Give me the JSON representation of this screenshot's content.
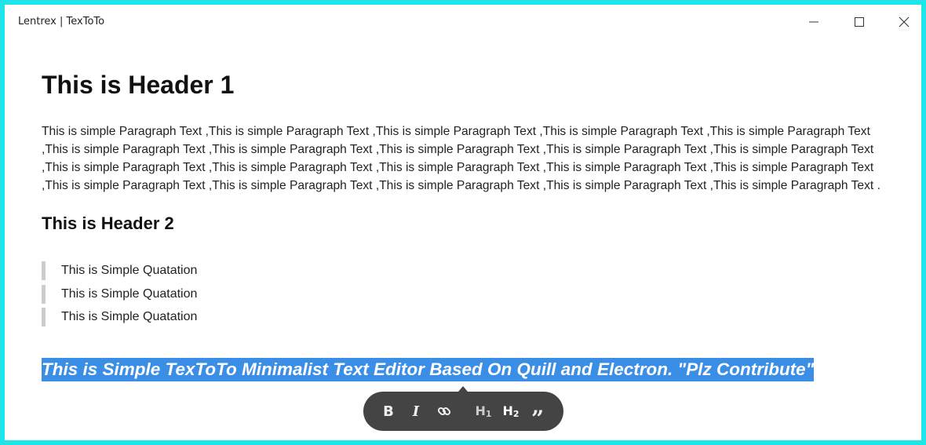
{
  "window": {
    "title": "Lentrex | TexToTo",
    "border_color": "#1ee5e8"
  },
  "controls": {
    "minimize_icon": "minimize-icon",
    "maximize_icon": "maximize-icon",
    "close_icon": "close-icon"
  },
  "document": {
    "header1": "This is Header 1",
    "paragraph": "This is simple Paragraph Text ,This is simple Paragraph Text ,This is simple Paragraph Text ,This is simple Paragraph Text ,This is simple Paragraph Text ,This is simple Paragraph Text ,This is simple Paragraph Text ,This is simple Paragraph Text ,This is simple Paragraph Text ,This is simple Paragraph Text ,This is simple Paragraph Text ,This is simple Paragraph Text ,This is simple Paragraph Text ,This is simple Paragraph Text ,This is simple Paragraph Text ,This is simple Paragraph Text ,This is simple Paragraph Text ,This is simple Paragraph Text ,This is simple Paragraph Text ,This is simple Paragraph Text .",
    "header2": "This is Header 2",
    "quotes": [
      "This is Simple Quatation",
      "This is Simple Quatation",
      "This is Simple Quatation"
    ],
    "selected_text": "This is Simple TexToTo Minimalist Text Editor Based On Quill and Electron. \"Plz Contribute\"",
    "selection_color": "#3a8ee6"
  },
  "toolbar": {
    "bold_label": "B",
    "italic_label": "I",
    "link_icon": "link-icon",
    "h1_label": "H",
    "h1_sub": "1",
    "h2_label": "H",
    "h2_sub": "2",
    "quote_label": "”",
    "background": "#444444"
  }
}
